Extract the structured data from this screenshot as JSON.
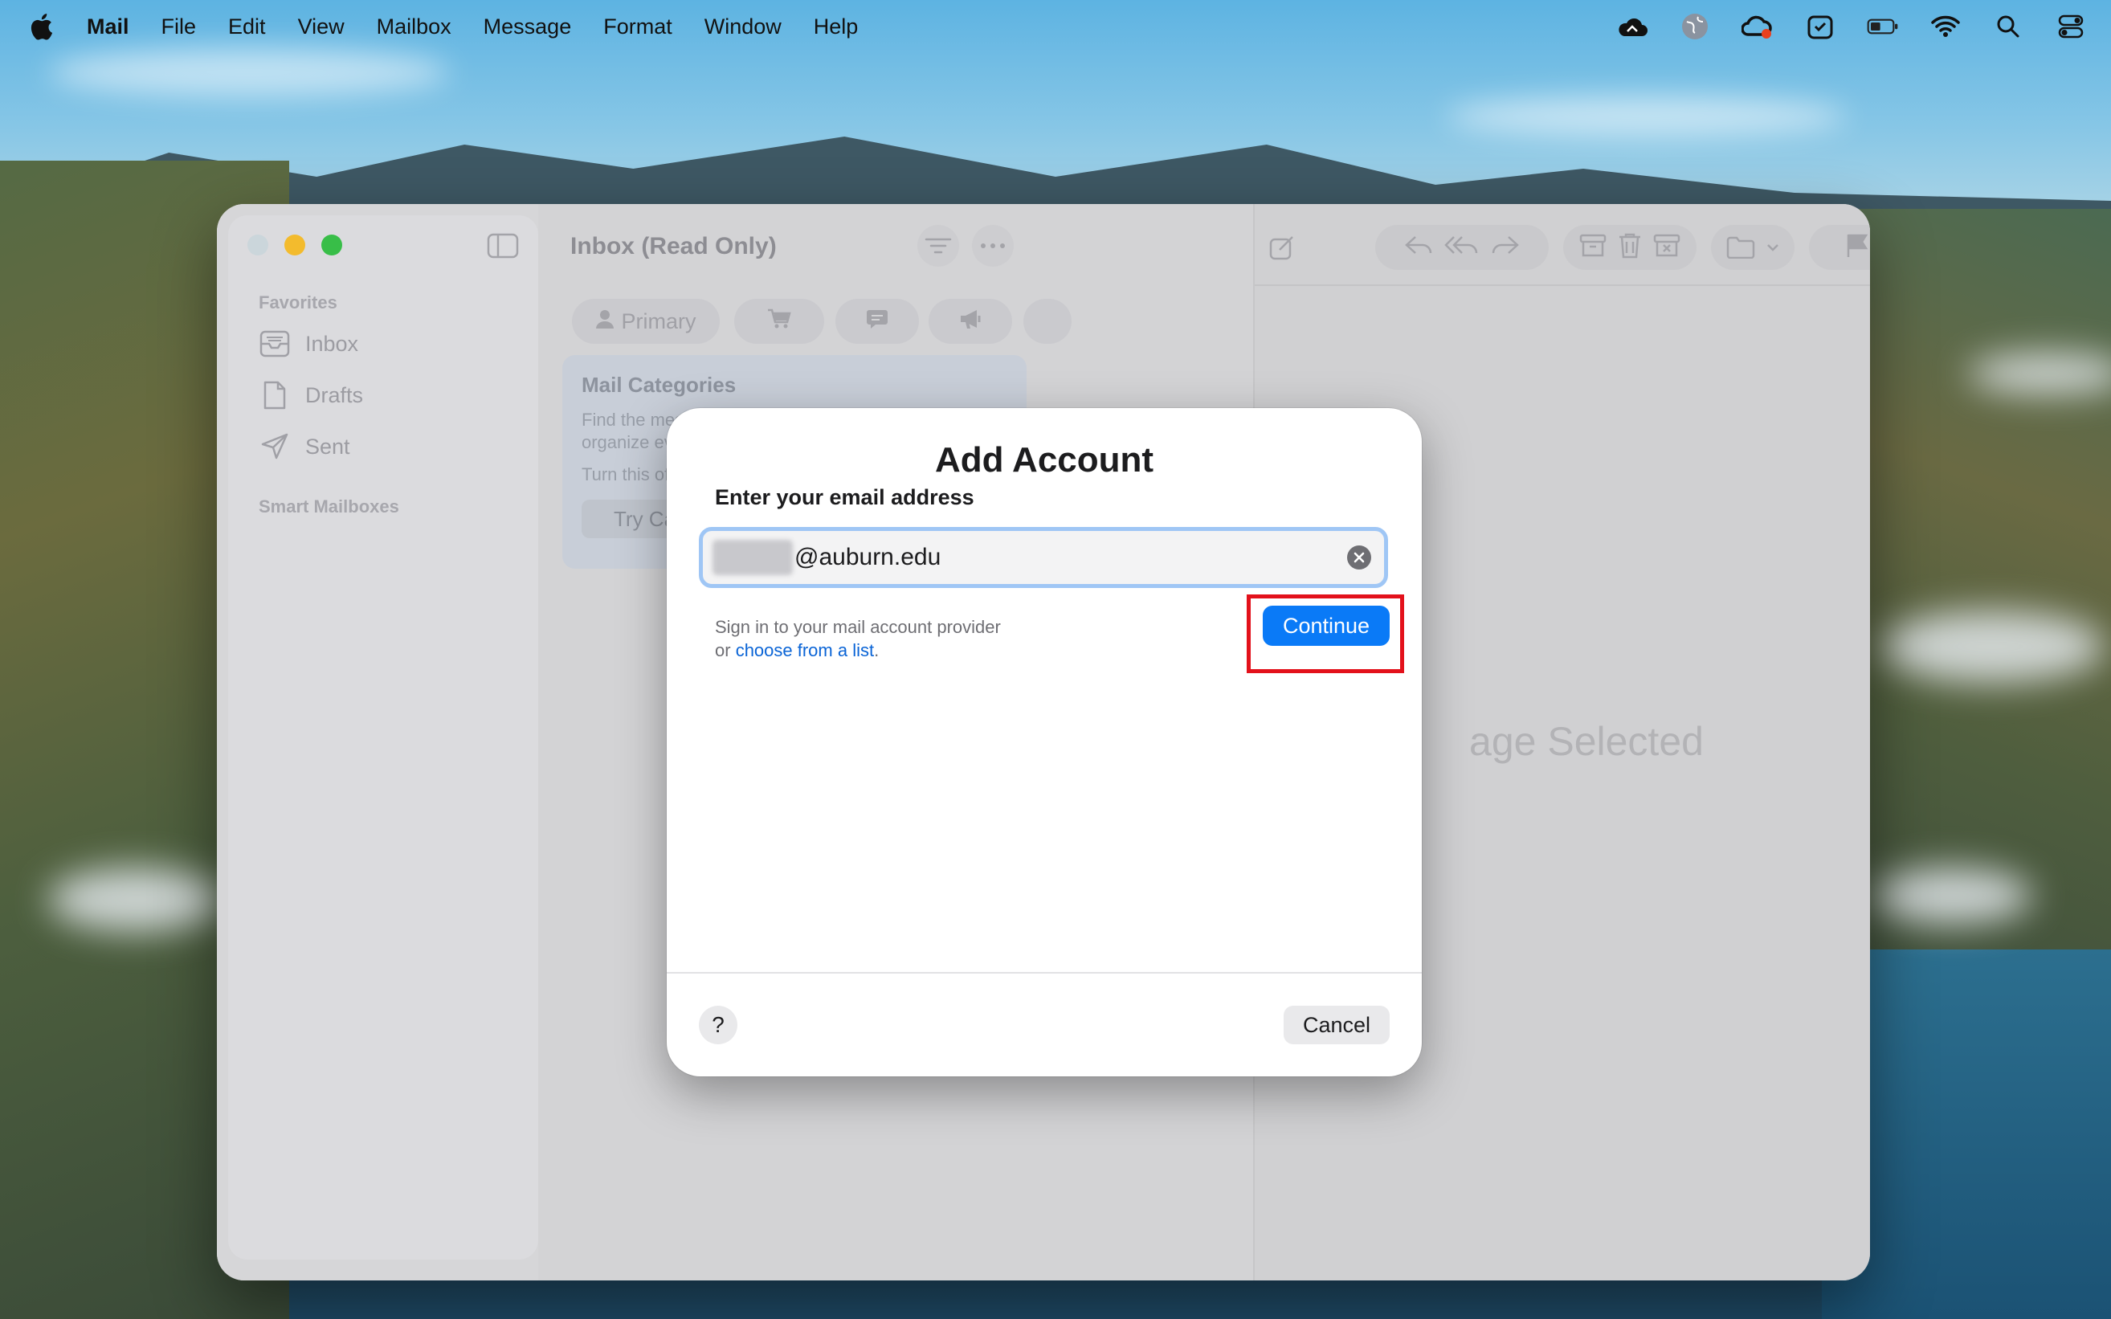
{
  "menubar": {
    "app": "Mail",
    "items": [
      "File",
      "Edit",
      "View",
      "Mailbox",
      "Message",
      "Format",
      "Window",
      "Help"
    ]
  },
  "sidebar": {
    "favorites_header": "Favorites",
    "items": [
      {
        "label": "Inbox",
        "icon": "inbox-icon"
      },
      {
        "label": "Drafts",
        "icon": "document-icon"
      },
      {
        "label": "Sent",
        "icon": "paper-plane-icon"
      }
    ],
    "smart_header": "Smart Mailboxes"
  },
  "message_list": {
    "title": "Inbox (Read Only)",
    "tabs": [
      {
        "label": "Primary",
        "icon": "person-icon"
      },
      {
        "label": "",
        "icon": "cart-icon"
      },
      {
        "label": "",
        "icon": "chat-bubble-icon"
      },
      {
        "label": "",
        "icon": "megaphone-icon"
      }
    ],
    "card": {
      "title": "Mail Categories",
      "line1": "Find the mes",
      "line2": "organize ev",
      "line3": "Turn this of",
      "button": "Try Ca"
    }
  },
  "detail": {
    "empty_text": "age Selected"
  },
  "dialog": {
    "title": "Add Account",
    "label": "Enter your email address",
    "email_value": "@auburn.edu",
    "hint_line1": "Sign in to your mail account provider",
    "hint_line2_prefix": "or ",
    "hint_link": "choose from a list",
    "hint_line2_suffix": ".",
    "continue_label": "Continue",
    "help_label": "?",
    "cancel_label": "Cancel"
  },
  "colors": {
    "accent": "#0a7af7",
    "highlight": "#e3111b",
    "link": "#0a64d6"
  }
}
